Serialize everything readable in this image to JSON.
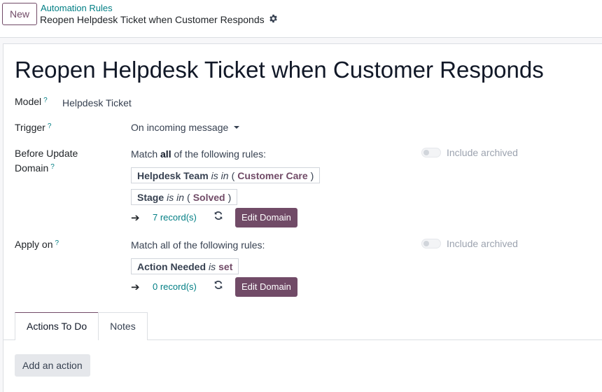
{
  "control_panel": {
    "new_label": "New",
    "breadcrumb": "Automation Rules",
    "record_name": "Reopen Helpdesk Ticket when Customer Responds",
    "settings_icon": "gear-icon"
  },
  "form": {
    "title": "Reopen Helpdesk Ticket when Customer Responds",
    "model": {
      "label": "Model",
      "help": "?",
      "value": "Helpdesk Ticket"
    },
    "trigger": {
      "label": "Trigger",
      "help": "?",
      "value": "On incoming message"
    },
    "before_update_domain": {
      "label_line1": "Before Update",
      "label_line2": "Domain",
      "help": "?",
      "match_prefix": "Match ",
      "match_bold": "all",
      "match_suffix": " of the following rules:",
      "include_archived": "Include archived",
      "rules": [
        {
          "field": "Helpdesk Team",
          "operator": "is in",
          "open": "(",
          "value": "Customer Care",
          "close": ")"
        },
        {
          "field": "Stage",
          "operator": "is in",
          "open": "(",
          "value": "Solved",
          "close": ")"
        }
      ],
      "records": "7 record(s)",
      "edit_label": "Edit Domain"
    },
    "apply_on": {
      "label": "Apply on",
      "help": "?",
      "match_text": "Match all of the following rules:",
      "include_archived": "Include archived",
      "rules": [
        {
          "field": "Action Needed",
          "operator": "is",
          "value": "set"
        }
      ],
      "records": "0 record(s)",
      "edit_label": "Edit Domain"
    }
  },
  "tabs": [
    {
      "label": "Actions To Do",
      "active": true
    },
    {
      "label": "Notes",
      "active": false
    }
  ],
  "add_action_label": "Add an action",
  "colors": {
    "brand": "#714b67",
    "link": "#017e84"
  }
}
